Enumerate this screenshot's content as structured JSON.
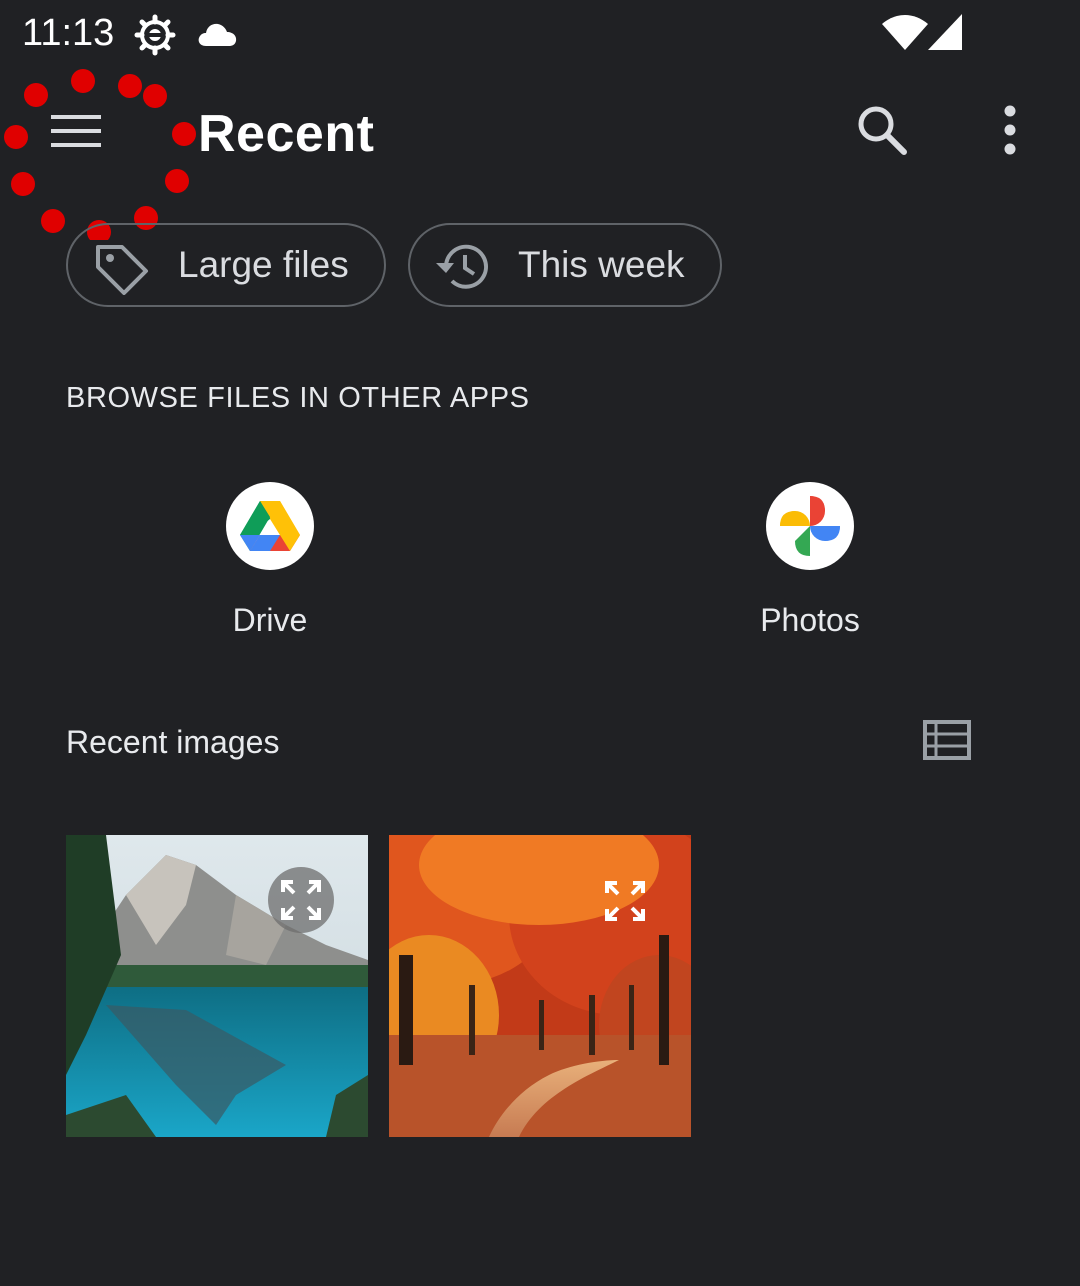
{
  "status_bar": {
    "time": "11:13",
    "icons": [
      "settings-gear-icon",
      "cloud-icon",
      "wifi-icon",
      "cell-signal-icon"
    ]
  },
  "app_bar": {
    "title": "Recent",
    "icons": [
      "menu-icon",
      "search-icon",
      "more-vert-icon"
    ]
  },
  "chips": [
    {
      "label": "Large files",
      "icon": "tag-icon"
    },
    {
      "label": "This week",
      "icon": "history-icon"
    }
  ],
  "browse_section": {
    "header": "BROWSE FILES IN OTHER APPS",
    "apps": [
      {
        "label": "Drive",
        "icon": "google-drive-icon"
      },
      {
        "label": "Photos",
        "icon": "google-photos-icon"
      }
    ]
  },
  "recent_images": {
    "title": "Recent images",
    "view_toggle_icon": "list-view-icon",
    "items": [
      {
        "subject": "mountain-lake",
        "icon": "expand-icon"
      },
      {
        "subject": "autumn-forest-path",
        "icon": "expand-icon"
      }
    ]
  },
  "colors": {
    "background": "#202124",
    "text_primary": "#ffffff",
    "text_secondary": "#dadce0",
    "chip_border": "#5f6368",
    "tap_indicator": "#e00000"
  }
}
